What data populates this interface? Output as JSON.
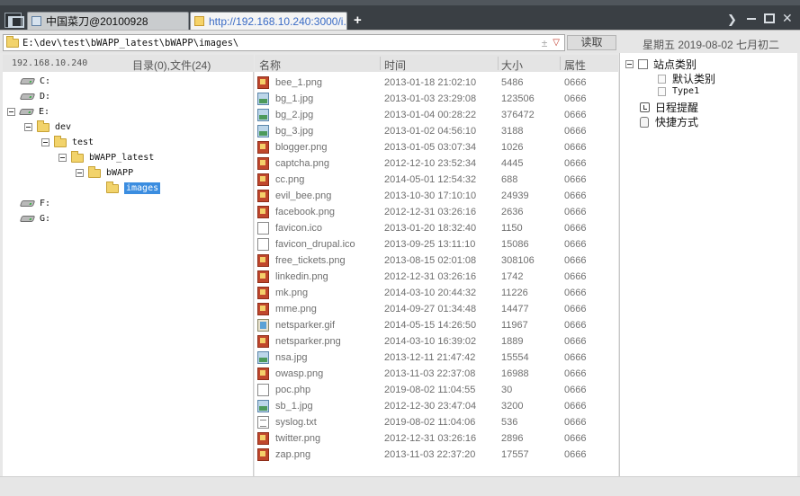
{
  "tabs": [
    {
      "label": "中国菜刀@20100928",
      "active": false
    },
    {
      "label": "http://192.168.10.240:3000/i...",
      "active": true
    }
  ],
  "new_tab_label": "+",
  "window_controls": {
    "next": "❯",
    "close": "✕"
  },
  "address": {
    "path": "E:\\dev\\test\\bWAPP_latest\\bWAPP\\images\\",
    "plus": "±",
    "dropdown": "▽",
    "read_button": "读取",
    "date": "星期五 2019-08-02 七月初二"
  },
  "left_header": {
    "ip": "192.168.10.240",
    "count": "目录(0),文件(24)"
  },
  "columns": {
    "name": "名称",
    "time": "时间",
    "size": "大小",
    "attr": "属性"
  },
  "tree": [
    {
      "label": "C:",
      "type": "drive",
      "expanded": false
    },
    {
      "label": "D:",
      "type": "drive",
      "expanded": false
    },
    {
      "label": "E:",
      "type": "drive",
      "expanded": true
    },
    {
      "label": "dev",
      "type": "folder",
      "expanded": true
    },
    {
      "label": "test",
      "type": "folder",
      "expanded": true
    },
    {
      "label": "bWAPP_latest",
      "type": "folder",
      "expanded": true
    },
    {
      "label": "bWAPP",
      "type": "folder",
      "expanded": true
    },
    {
      "label": "images",
      "type": "folder",
      "selected": true
    },
    {
      "label": "F:",
      "type": "drive",
      "expanded": false
    },
    {
      "label": "G:",
      "type": "drive",
      "expanded": false
    }
  ],
  "files": [
    {
      "name": "bee_1.png",
      "time": "2013-01-18 21:02:10",
      "size": "5486",
      "attr": "0666",
      "icon": "png-icon"
    },
    {
      "name": "bg_1.jpg",
      "time": "2013-01-03 23:29:08",
      "size": "123506",
      "attr": "0666",
      "icon": "jpg-icon"
    },
    {
      "name": "bg_2.jpg",
      "time": "2013-01-04 00:28:22",
      "size": "376472",
      "attr": "0666",
      "icon": "jpg-icon"
    },
    {
      "name": "bg_3.jpg",
      "time": "2013-01-02 04:56:10",
      "size": "3188",
      "attr": "0666",
      "icon": "jpg-icon"
    },
    {
      "name": "blogger.png",
      "time": "2013-01-05 03:07:34",
      "size": "1026",
      "attr": "0666",
      "icon": "png-icon"
    },
    {
      "name": "captcha.png",
      "time": "2012-12-10 23:52:34",
      "size": "4445",
      "attr": "0666",
      "icon": "png-icon"
    },
    {
      "name": "cc.png",
      "time": "2014-05-01 12:54:32",
      "size": "688",
      "attr": "0666",
      "icon": "png-icon"
    },
    {
      "name": "evil_bee.png",
      "time": "2013-10-30 17:10:10",
      "size": "24939",
      "attr": "0666",
      "icon": "png-icon"
    },
    {
      "name": "facebook.png",
      "time": "2012-12-31 03:26:16",
      "size": "2636",
      "attr": "0666",
      "icon": "png-icon"
    },
    {
      "name": "favicon.ico",
      "time": "2013-01-20 18:32:40",
      "size": "1150",
      "attr": "0666",
      "icon": "doc-icon"
    },
    {
      "name": "favicon_drupal.ico",
      "time": "2013-09-25 13:11:10",
      "size": "15086",
      "attr": "0666",
      "icon": "doc-icon"
    },
    {
      "name": "free_tickets.png",
      "time": "2013-08-15 02:01:08",
      "size": "308106",
      "attr": "0666",
      "icon": "png-icon"
    },
    {
      "name": "linkedin.png",
      "time": "2012-12-31 03:26:16",
      "size": "1742",
      "attr": "0666",
      "icon": "png-icon"
    },
    {
      "name": "mk.png",
      "time": "2014-03-10 20:44:32",
      "size": "11226",
      "attr": "0666",
      "icon": "png-icon"
    },
    {
      "name": "mme.png",
      "time": "2014-09-27 01:34:48",
      "size": "14477",
      "attr": "0666",
      "icon": "png-icon"
    },
    {
      "name": "netsparker.gif",
      "time": "2014-05-15 14:26:50",
      "size": "11967",
      "attr": "0666",
      "icon": "gif-icon"
    },
    {
      "name": "netsparker.png",
      "time": "2014-03-10 16:39:02",
      "size": "1889",
      "attr": "0666",
      "icon": "png-icon"
    },
    {
      "name": "nsa.jpg",
      "time": "2013-12-11 21:47:42",
      "size": "15554",
      "attr": "0666",
      "icon": "jpg-icon"
    },
    {
      "name": "owasp.png",
      "time": "2013-11-03 22:37:08",
      "size": "16988",
      "attr": "0666",
      "icon": "png-icon"
    },
    {
      "name": "poc.php",
      "time": "2019-08-02 11:04:55",
      "size": "30",
      "attr": "0666",
      "icon": "doc-icon"
    },
    {
      "name": "sb_1.jpg",
      "time": "2012-12-30 23:47:04",
      "size": "3200",
      "attr": "0666",
      "icon": "jpg-icon"
    },
    {
      "name": "syslog.txt",
      "time": "2019-08-02 11:04:06",
      "size": "536",
      "attr": "0666",
      "icon": "txt-icon"
    },
    {
      "name": "twitter.png",
      "time": "2012-12-31 03:26:16",
      "size": "2896",
      "attr": "0666",
      "icon": "png-icon"
    },
    {
      "name": "zap.png",
      "time": "2013-11-03 22:37:20",
      "size": "17557",
      "attr": "0666",
      "icon": "png-icon"
    }
  ],
  "right_panel": {
    "category": "站点类别",
    "default_category": "默认类别",
    "type1": "Type1",
    "schedule": "日程提醒",
    "shortcuts": "快捷方式"
  },
  "colors": {
    "selection": "#3b8de0",
    "active_tab_text": "#3b6cc6",
    "titlebar": "#3a3f44"
  }
}
